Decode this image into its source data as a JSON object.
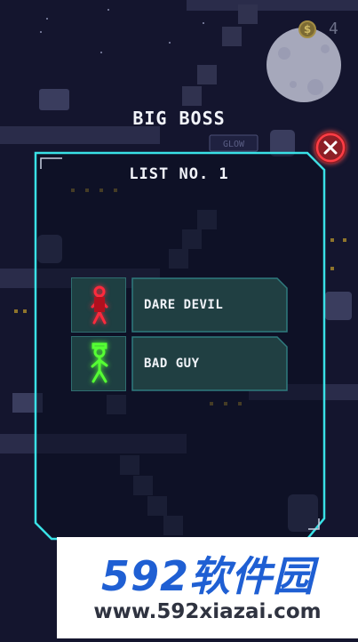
{
  "hud": {
    "coin_symbol": "$",
    "coin_count": "4"
  },
  "title": "BIG BOSS",
  "subtitle": "LIST NO. 1",
  "close_icon": "close-x-icon",
  "characters": [
    {
      "name": "DARE DEVIL",
      "color": "#ff2a3d",
      "icon": "stickman-red-icon"
    },
    {
      "name": "BAD GUY",
      "color": "#55ff33",
      "icon": "stickman-green-icon"
    }
  ],
  "background_sign": "GLOW",
  "watermark": {
    "logo": "592软件园",
    "url": "www.592xiazai.com"
  },
  "colors": {
    "frame": "#39e1e6",
    "background": "#14152e",
    "close": "#e23a3f"
  }
}
